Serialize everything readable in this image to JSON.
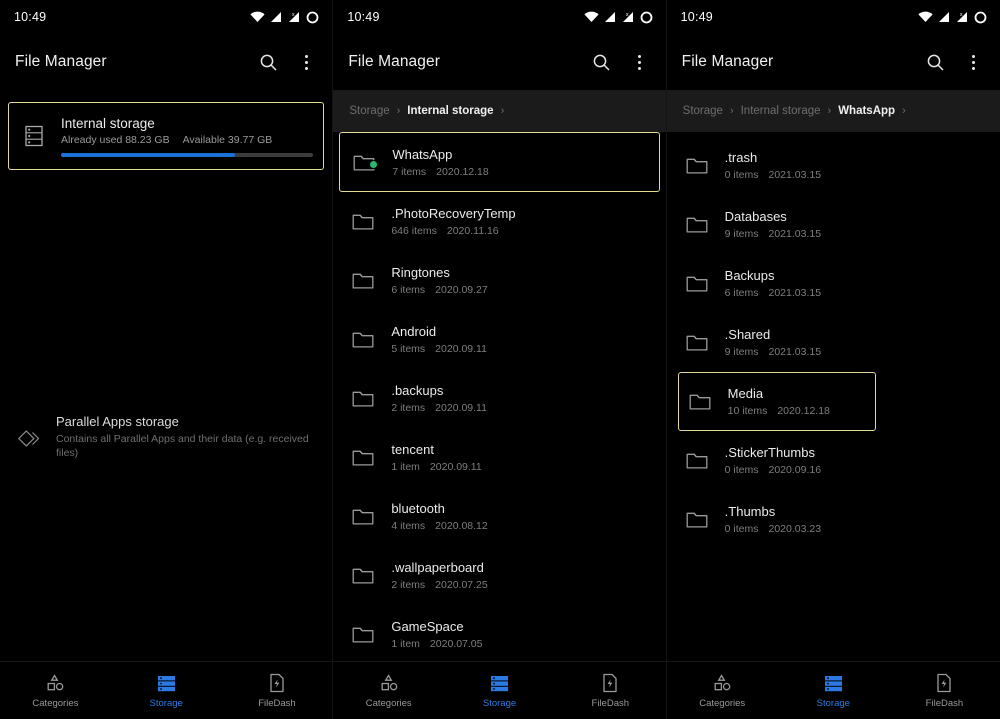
{
  "status": {
    "time": "10:49",
    "icons": [
      "wifi-icon",
      "signal-icon",
      "signal-x-icon",
      "battery-icon"
    ]
  },
  "app": {
    "title": "File Manager",
    "search_icon": "search-icon",
    "overflow_icon": "more-vertical-icon"
  },
  "colors": {
    "accent_blue": "#2c7be5",
    "progress_blue": "#1b72d6",
    "highlight_border": "#e2da92",
    "badge_green": "#2bb673",
    "background": "#000000",
    "crumb_background": "#1b1b1b"
  },
  "bottom_nav": {
    "items": [
      {
        "label": "Categories",
        "icon": "categories-icon",
        "active": false
      },
      {
        "label": "Storage",
        "icon": "storage-icon",
        "active": true
      },
      {
        "label": "FileDash",
        "icon": "filedash-icon",
        "active": false
      }
    ]
  },
  "panel1": {
    "storage_card": {
      "icon": "internal-storage-icon",
      "title": "Internal storage",
      "used_label": "Already used 88.23 GB",
      "available_label": "Available 39.77 GB",
      "used_gb": 88.23,
      "available_gb": 39.77,
      "percent_used": 69
    },
    "parallel": {
      "icon": "parallel-apps-icon",
      "title": "Parallel Apps storage",
      "description": "Contains all Parallel Apps and their data (e.g. received files)"
    }
  },
  "panel2": {
    "breadcrumb": [
      {
        "label": "Storage",
        "active": false
      },
      {
        "label": "Internal storage",
        "active": true
      }
    ],
    "files": [
      {
        "name": "WhatsApp",
        "items": "7 items",
        "date": "2020.12.18",
        "selected": true,
        "badge": true
      },
      {
        "name": ".PhotoRecoveryTemp",
        "items": "646 items",
        "date": "2020.11.16",
        "selected": false,
        "badge": false
      },
      {
        "name": "Ringtones",
        "items": "6 items",
        "date": "2020.09.27",
        "selected": false,
        "badge": false
      },
      {
        "name": "Android",
        "items": "5 items",
        "date": "2020.09.11",
        "selected": false,
        "badge": false
      },
      {
        "name": ".backups",
        "items": "2 items",
        "date": "2020.09.11",
        "selected": false,
        "badge": false
      },
      {
        "name": "tencent",
        "items": "1 item",
        "date": "2020.09.11",
        "selected": false,
        "badge": false
      },
      {
        "name": "bluetooth",
        "items": "4 items",
        "date": "2020.08.12",
        "selected": false,
        "badge": false
      },
      {
        "name": ".wallpaperboard",
        "items": "2 items",
        "date": "2020.07.25",
        "selected": false,
        "badge": false
      },
      {
        "name": "GameSpace",
        "items": "1 item",
        "date": "2020.07.05",
        "selected": false,
        "badge": false
      }
    ]
  },
  "panel3": {
    "breadcrumb": [
      {
        "label": "Storage",
        "active": false
      },
      {
        "label": "Internal storage",
        "active": false
      },
      {
        "label": "WhatsApp",
        "active": true
      }
    ],
    "files": [
      {
        "name": ".trash",
        "items": "0 items",
        "date": "2021.03.15",
        "selected": false,
        "badge": false
      },
      {
        "name": "Databases",
        "items": "9 items",
        "date": "2021.03.15",
        "selected": false,
        "badge": false
      },
      {
        "name": "Backups",
        "items": "6 items",
        "date": "2021.03.15",
        "selected": false,
        "badge": false
      },
      {
        "name": ".Shared",
        "items": "9 items",
        "date": "2021.03.15",
        "selected": false,
        "badge": false
      },
      {
        "name": "Media",
        "items": "10 items",
        "date": "2020.12.18",
        "selected": true,
        "badge": false
      },
      {
        "name": ".StickerThumbs",
        "items": "0 items",
        "date": "2020.09.16",
        "selected": false,
        "badge": false
      },
      {
        "name": ".Thumbs",
        "items": "0 items",
        "date": "2020.03.23",
        "selected": false,
        "badge": false
      }
    ]
  }
}
